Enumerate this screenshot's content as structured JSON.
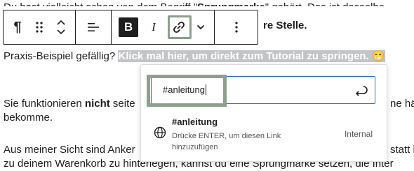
{
  "paragraphs": {
    "p1": {
      "before": "Du hast vielleicht schon von dem Begriff \"",
      "bold": "Sprungmarke",
      "after": "\" gehört. Das ist dasselbe -"
    },
    "p1_line2_bold": "re Stelle.",
    "p2": {
      "text": "Praxis-Beispiel gefällig? ",
      "highlighted": "Klick mal hier, um direkt zum Tutorial zu springen. 😁"
    },
    "p3": {
      "before": "Sie funktionieren ",
      "bold": "nicht",
      "after": " seite",
      "right": "ne hä",
      "line2": "bekomme."
    },
    "p4": {
      "line1_left": "Aus meiner Sicht sind Anker",
      "line1_right": "statt h",
      "line2": "zu deinem Warenkorb zu hinterlegen, kannst du eine Sprungmarke setzen, die Inter"
    }
  },
  "toolbar": {
    "paragraph_label": "¶",
    "bold_label": "B",
    "italic_label": "I"
  },
  "link_popover": {
    "search_value": "#anleitung",
    "suggestion": {
      "title": "#anleitung",
      "description": "Drücke ENTER, um diesen Link hinzuzufügen",
      "type": "Internal"
    }
  },
  "colors": {
    "highlight": "#c3c4c7",
    "focus_outline": "#8da08d",
    "input_border": "#2271b1"
  }
}
